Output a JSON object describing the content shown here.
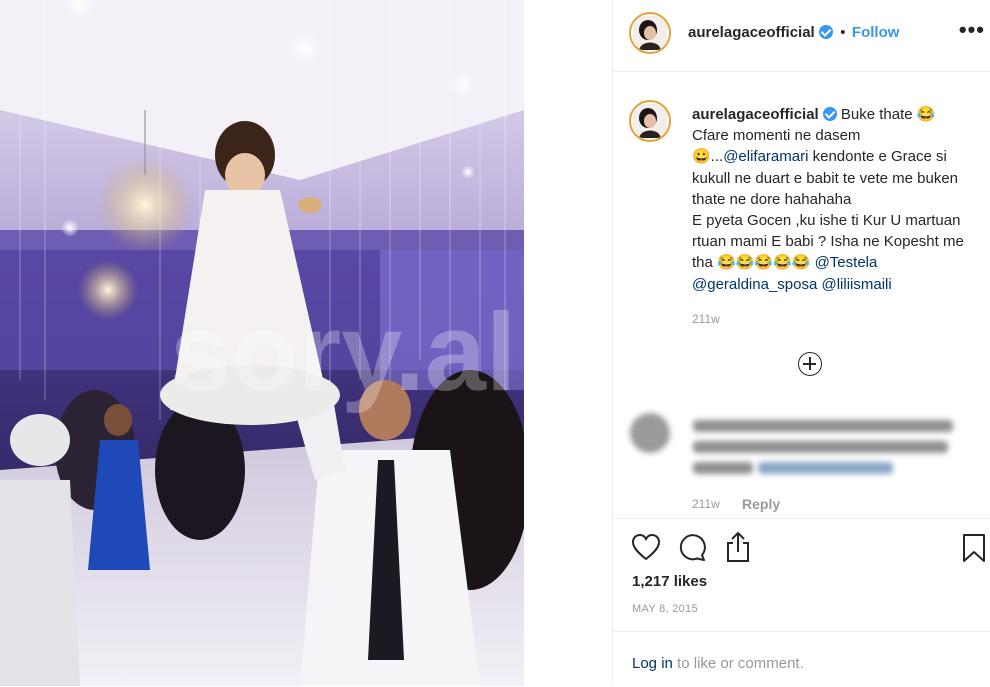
{
  "post": {
    "username": "aurelagaceofficial",
    "follow_label": "Follow",
    "separator": "•",
    "more_label": "•••"
  },
  "caption": {
    "username": "aurelagaceofficial",
    "line1": "Buke thate 😂",
    "line2": "Cfare momenti ne dasem",
    "line3_prefix": "😀...",
    "mention1": "@elifaramari",
    "line3_rest": " kendonte e Grace si kukull ne duart e babit te vete me buken thate ne dore hahahaha",
    "line4": "E pyeta Gocen ,ku ishe ti Kur U martuan rtuan mami E babi ? Isha ne Kopesht me tha 😂😂😂😂😂 ",
    "mention2": "@Testela",
    "mention3": "@geraldina_sposa",
    "mention4": "@liliismaili",
    "time": "211w"
  },
  "comment": {
    "time": "211w",
    "reply_label": "Reply"
  },
  "stats": {
    "likes": "1,217 likes",
    "date": "MAY 8, 2015"
  },
  "login": {
    "link": "Log in",
    "rest": " to like or comment."
  },
  "watermark": "sory.al",
  "icons": [
    "heart-icon",
    "comment-icon",
    "share-icon",
    "bookmark-icon",
    "plus-circle-icon",
    "verified-badge-icon",
    "more-options-icon"
  ],
  "colors": {
    "accent": "#3897f0",
    "text": "#262626",
    "muted": "#999999",
    "mention": "#003569"
  }
}
